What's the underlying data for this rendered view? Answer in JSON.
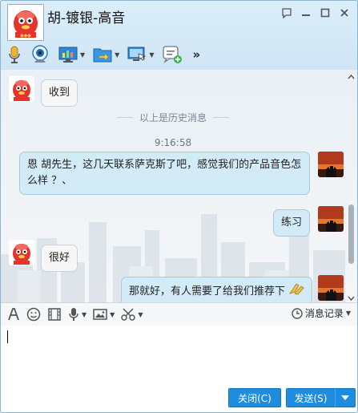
{
  "window": {
    "title": "胡-镀银-高音"
  },
  "toolbar": {
    "items": [
      {
        "icon": "microphone-icon"
      },
      {
        "icon": "webcam-icon"
      },
      {
        "icon": "remote-desktop-icon"
      },
      {
        "icon": "file-transfer-icon"
      },
      {
        "icon": "screen-share-icon"
      },
      {
        "icon": "app-add-icon"
      }
    ],
    "more": "»"
  },
  "chat": {
    "history_label": "以上是历史消息",
    "timestamp": "9:16:58",
    "messages": [
      {
        "side": "left",
        "text": "收到"
      },
      {
        "side": "right",
        "text": "恩 胡先生，这几天联系萨克斯了吧，感觉我们的产品音色怎么样 ？、"
      },
      {
        "side": "right",
        "text": "练习"
      },
      {
        "side": "left",
        "text": "很好"
      },
      {
        "side": "right",
        "text": "那就好，有人需要了给我们推荐下"
      }
    ]
  },
  "input_toolbar": {
    "history_button": "消息记录"
  },
  "buttons": {
    "close": "关闭(C)",
    "send": "发送(S)"
  },
  "colors": {
    "accent": "#1e8de0",
    "bubble_right": "#d3ebf7",
    "bubble_left": "#f7f7f7"
  }
}
